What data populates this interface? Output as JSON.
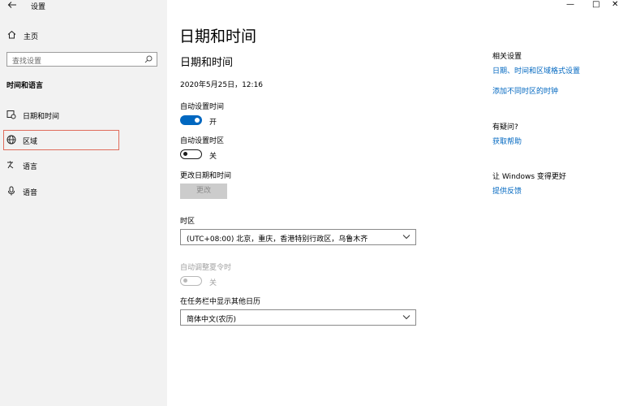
{
  "window": {
    "title": "设置",
    "controls": {
      "minimize": "—",
      "maximize": "□",
      "close": "✕"
    }
  },
  "sidebar": {
    "home_label": "主页",
    "search_placeholder": "查找设置",
    "section_title": "时间和语言",
    "items": [
      {
        "label": "日期和时间",
        "icon": "calendar-clock-icon"
      },
      {
        "label": "区域",
        "icon": "globe-icon"
      },
      {
        "label": "语言",
        "icon": "language-icon"
      },
      {
        "label": "语音",
        "icon": "microphone-icon"
      }
    ],
    "selected_index": 1
  },
  "main": {
    "page_title": "日期和时间",
    "section_title": "日期和时间",
    "current_datetime": "2020年5月25日，12:16",
    "auto_time": {
      "label": "自动设置时间",
      "state": "开",
      "on": true
    },
    "auto_timezone": {
      "label": "自动设置时区",
      "state": "关",
      "on": false
    },
    "change_datetime": {
      "label": "更改日期和时间",
      "button": "更改"
    },
    "timezone": {
      "label": "时区",
      "value": "(UTC+08:00) 北京，重庆，香港特别行政区，乌鲁木齐"
    },
    "dst": {
      "label": "自动调整夏令时",
      "state": "关",
      "enabled": false
    },
    "taskbar_calendar": {
      "label": "在任务栏中显示其他日历",
      "value": "简体中文(农历)"
    }
  },
  "related": {
    "title": "相关设置",
    "links": [
      "日期、时间和区域格式设置",
      "添加不同时区的时钟"
    ]
  },
  "help": {
    "title": "有疑问?",
    "link": "获取帮助"
  },
  "feedback": {
    "title": "让 Windows 变得更好",
    "link": "提供反馈"
  },
  "colors": {
    "accent": "#0067c0",
    "sidebar_bg": "#f2f2f2",
    "selection_outline": "#e06c5c"
  }
}
